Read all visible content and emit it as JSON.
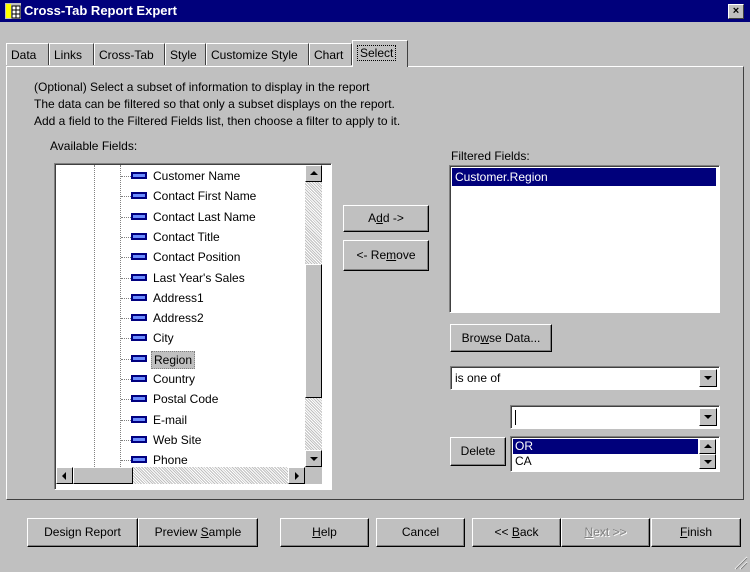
{
  "window": {
    "title": "Cross-Tab Report Expert",
    "close_label": "×"
  },
  "tabs": [
    {
      "label": "Data"
    },
    {
      "label": "Links"
    },
    {
      "label": "Cross-Tab"
    },
    {
      "label": "Style"
    },
    {
      "label": "Customize Style"
    },
    {
      "label": "Chart"
    },
    {
      "label": "Select"
    }
  ],
  "instructions": [
    "(Optional) Select a subset of information to display in the report",
    "The data can be filtered so that only a subset displays on the report.",
    "Add a field to the Filtered Fields list, then choose a filter to apply to it."
  ],
  "available_fields": {
    "label": "Available Fields:",
    "items": [
      "Customer Name",
      "Contact First Name",
      "Contact Last Name",
      "Contact Title",
      "Contact Position",
      "Last Year's Sales",
      "Address1",
      "Address2",
      "City",
      "Region",
      "Country",
      "Postal Code",
      "E-mail",
      "Web Site",
      "Phone"
    ],
    "selected": "Region"
  },
  "buttons": {
    "add_pre": "A",
    "add_u": "d",
    "add_post": "d ->",
    "remove_pre": "<- Re",
    "remove_u": "m",
    "remove_post": "ove",
    "browse_pre": "Bro",
    "browse_u": "w",
    "browse_post": "se Data...",
    "delete": "Delete"
  },
  "filtered_fields": {
    "label": "Filtered Fields:",
    "items": [
      "Customer.Region"
    ]
  },
  "filter": {
    "operator": "is one of",
    "value_input": "",
    "values": [
      "OR",
      "CA"
    ]
  },
  "footer": {
    "design_report": "Design Report",
    "preview_pre": "Preview ",
    "preview_u": "S",
    "preview_post": "ample",
    "help_pre": "",
    "help_u": "H",
    "help_post": "elp",
    "cancel": "Cancel",
    "back_pre": "<< ",
    "back_u": "B",
    "back_post": "ack",
    "next_pre": "",
    "next_u": "N",
    "next_post": "ext >>",
    "finish_pre": "",
    "finish_u": "F",
    "finish_post": "inish"
  },
  "colors": {
    "titlebar": "#00007b",
    "selection": "#00007b",
    "face": "#c0c0c0"
  }
}
